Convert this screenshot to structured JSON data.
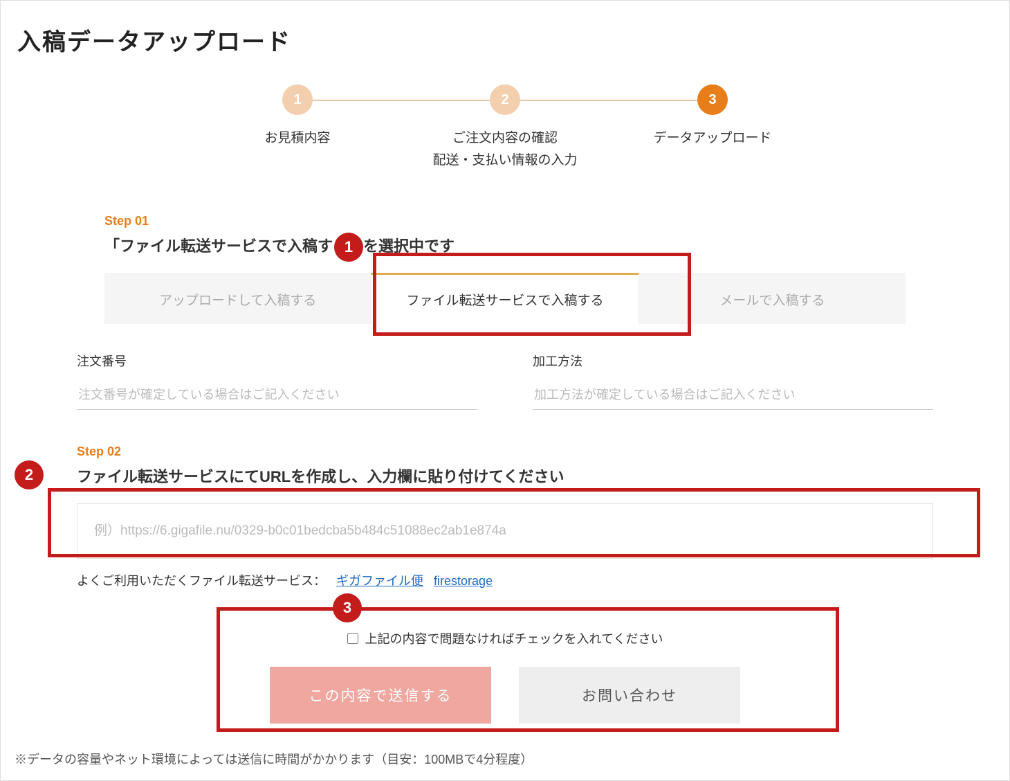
{
  "title": "入稿データアップロード",
  "stepper": {
    "s1": {
      "num": "1",
      "label": "お見積内容"
    },
    "s2": {
      "num": "2",
      "label": "ご注文内容の確認\n配送・支払い情報の入力"
    },
    "s3": {
      "num": "3",
      "label": "データアップロード"
    }
  },
  "step01": {
    "num": "Step 01",
    "heading": "「ファイル転送サービスで入稿する」を選択中です",
    "tabs": {
      "t1": "アップロードして入稿する",
      "t2": "ファイル転送サービスで入稿する",
      "t3": "メールで入稿する"
    }
  },
  "fields": {
    "orderNo": {
      "label": "注文番号",
      "placeholder": "注文番号が確定している場合はご記入ください"
    },
    "processing": {
      "label": "加工方法",
      "placeholder": "加工方法が確定している場合はご記入ください"
    }
  },
  "step02": {
    "num": "Step 02",
    "heading": "ファイル転送サービスにてURLを作成し、入力欄に貼り付けてください",
    "placeholder": "例）https://6.gigafile.nu/0329-b0c01bedcba5b484c51088ec2ab1e874a",
    "serviceLabel": "よくご利用いただくファイル転送サービス：",
    "links": {
      "giga": "ギガファイル便",
      "fire": "firestorage"
    }
  },
  "submit": {
    "cbLabel": "上記の内容で問題なければチェックを入れてください",
    "primary": "この内容で送信する",
    "secondary": "お問い合わせ"
  },
  "footnote": "※データの容量やネット環境によっては送信に時間がかかります（目安：100MBで4分程度）",
  "annot": {
    "a1": "1",
    "a2": "2",
    "a3": "3"
  }
}
